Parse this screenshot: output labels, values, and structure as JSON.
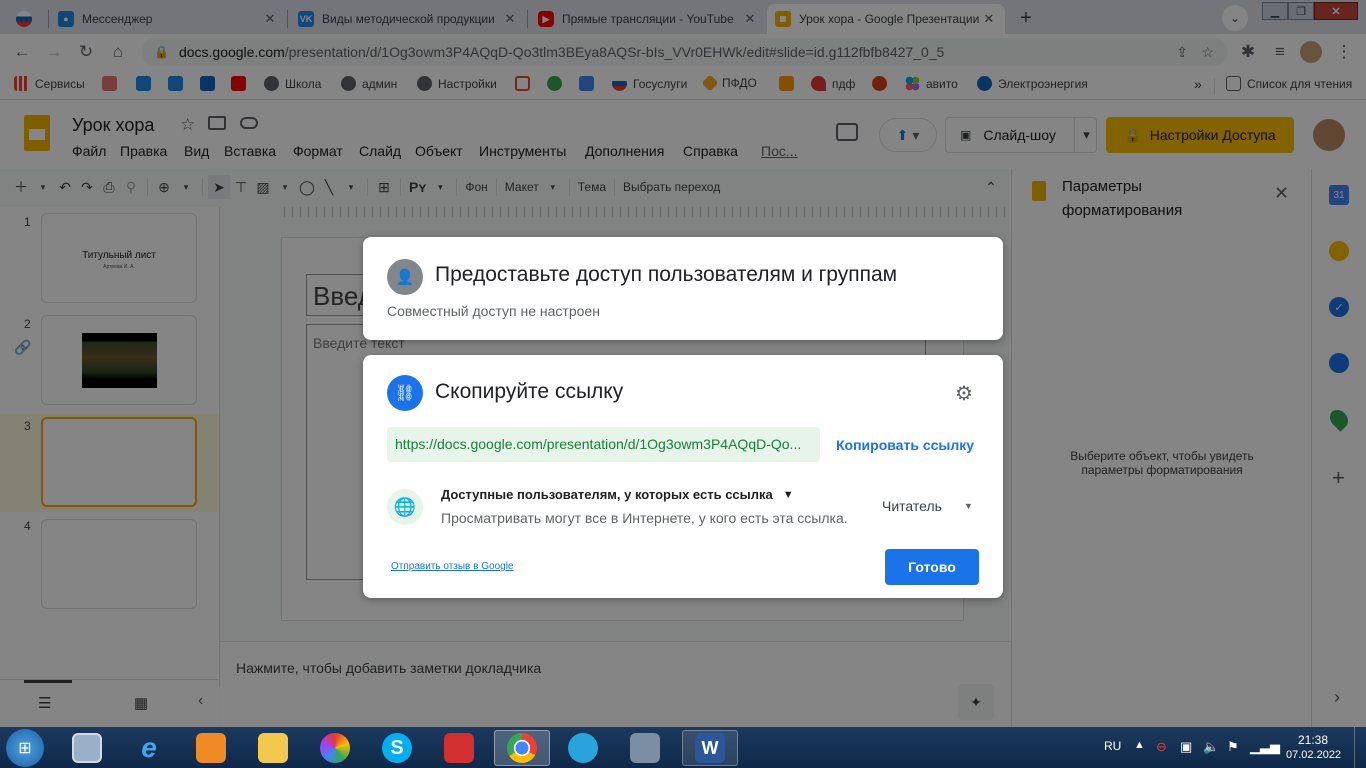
{
  "browser": {
    "tabs": [
      {
        "title": "",
        "color": "#e53935"
      },
      {
        "title": "Мессенджер",
        "color": "#1e88e5"
      },
      {
        "title": "Виды методической продукции",
        "color": "#2787f5"
      },
      {
        "title": "Прямые трансляции - YouTube",
        "color": "#ff0000"
      },
      {
        "title": "Урок хора - Google Презентации",
        "color": "#f4b400"
      }
    ],
    "url_domain": "docs.google.com",
    "url_path": "/presentation/d/1Og3owm3P4AQqD-Qo3tlm3BEya8AQSr-bIs_VVr0EHWk/edit#slide=id.g112fbfb8427_0_5",
    "bookmarks": [
      "Сервисы",
      "Школа",
      "админ",
      "Настройки",
      "Госуслуги",
      "ПФДО",
      "пдф",
      "авито",
      "Электроэнергия"
    ],
    "reading_list": "Список для чтения",
    "more": "»"
  },
  "doc": {
    "title": "Урок хора",
    "menu": [
      "Файл",
      "Правка",
      "Вид",
      "Вставка",
      "Формат",
      "Слайд",
      "Объект",
      "Инструменты",
      "Дополнения",
      "Справка",
      "Пос..."
    ],
    "slideshow": "Слайд-шоу",
    "share": "Настройки Доступа",
    "toolbar_text": [
      "Фон",
      "Макет",
      "Тема",
      "Выбрать переход"
    ]
  },
  "slides": [
    {
      "num": "1",
      "title": "Титульный лист",
      "sub": "Артеева И. А."
    },
    {
      "num": "2"
    },
    {
      "num": "3"
    },
    {
      "num": "4"
    }
  ],
  "canvas": {
    "title_placeholder": "Введ",
    "text_placeholder": "Введите текст"
  },
  "notes": "Нажмите, чтобы добавить заметки докладчика",
  "format_panel": {
    "title": "Параметры форматирования",
    "hint": "Выберите объект, чтобы увидеть параметры форматирования"
  },
  "share_dialog": {
    "people_title": "Предоставьте доступ пользователям и группам",
    "people_sub": "Совместный доступ не настроен",
    "link_title": "Скопируйте ссылку",
    "link_url": "https://docs.google.com/presentation/d/1Og3owm3P4AQqD-Qo...",
    "copy_link": "Копировать ссылку",
    "access_title": "Доступные пользователям, у которых есть ссылка",
    "access_desc": "Просматривать могут все в Интернете, у кого есть эта ссылка.",
    "role": "Читатель",
    "feedback": "Отправить отзыв в Google",
    "done": "Готово"
  },
  "taskbar": {
    "lang": "RU",
    "time": "21:38",
    "date": "07.02.2022"
  },
  "colors": {
    "accent": "#1a73e8",
    "share_btn": "#fbbc04",
    "link_bg": "#e6f4ea",
    "link_text": "#188038",
    "selected_slide": "#f9ab00"
  }
}
